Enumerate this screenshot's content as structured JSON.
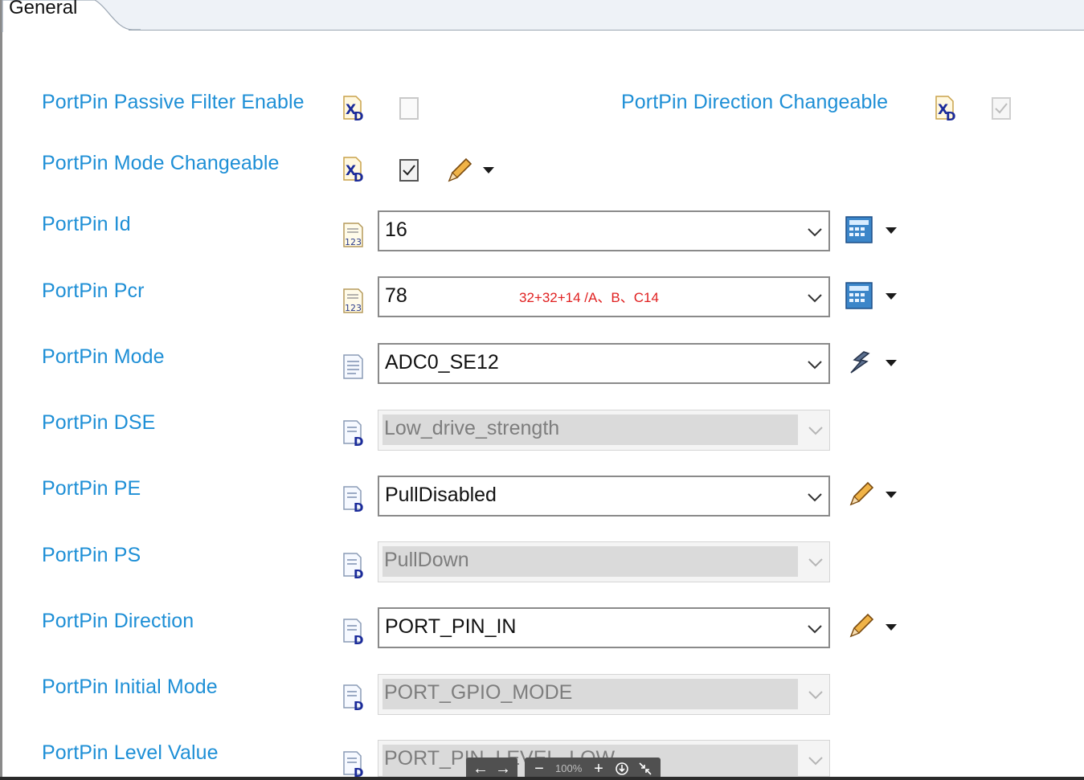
{
  "tab": {
    "label": "General"
  },
  "rows": [
    {
      "label": "PortPin Passive Filter Enable",
      "icon": "xd-icon",
      "control": "checkbox",
      "checked": false,
      "enabled": true
    },
    {
      "label": "PortPin Direction Changeable",
      "icon": "xd-icon",
      "control": "checkbox",
      "checked": true,
      "enabled": false
    },
    {
      "label": "PortPin Mode Changeable",
      "icon": "xd-icon",
      "control": "checkbox",
      "checked": true,
      "enabled": true,
      "action": "pencil-icon"
    },
    {
      "label": "PortPin Id",
      "icon": "number-icon",
      "control": "combo",
      "value": "16",
      "enabled": true,
      "action": "calculator-icon"
    },
    {
      "label": "PortPin Pcr",
      "icon": "number-icon",
      "control": "combo",
      "value": "78",
      "note": "32+32+14 /A、B、C14",
      "enabled": true,
      "action": "calculator-icon"
    },
    {
      "label": "PortPin Mode",
      "icon": "text-doc-icon",
      "control": "combo",
      "value": "ADC0_SE12",
      "enabled": true,
      "action": "link-icon"
    },
    {
      "label": "PortPin DSE",
      "icon": "doc-d-icon",
      "control": "combo",
      "value": "Low_drive_strength",
      "enabled": false
    },
    {
      "label": "PortPin PE",
      "icon": "doc-d-icon",
      "control": "combo",
      "value": "PullDisabled",
      "enabled": true,
      "action": "pencil-icon"
    },
    {
      "label": "PortPin PS",
      "icon": "doc-d-icon",
      "control": "combo",
      "value": "PullDown",
      "enabled": false
    },
    {
      "label": "PortPin Direction",
      "icon": "doc-d-icon",
      "control": "combo",
      "value": "PORT_PIN_IN",
      "enabled": true,
      "action": "pencil-icon"
    },
    {
      "label": "PortPin Initial Mode",
      "icon": "doc-d-icon",
      "control": "combo",
      "value": "PORT_GPIO_MODE",
      "enabled": false
    },
    {
      "label": "PortPin Level Value",
      "icon": "doc-d-icon",
      "control": "combo",
      "value": "PORT_PIN_LEVEL_LOW",
      "enabled": false
    }
  ],
  "viewer_toolbar": {
    "zoom": "100%"
  },
  "colors": {
    "label": "#1e8fd6",
    "note": "#e02020",
    "disabled_fill": "#dadada"
  }
}
